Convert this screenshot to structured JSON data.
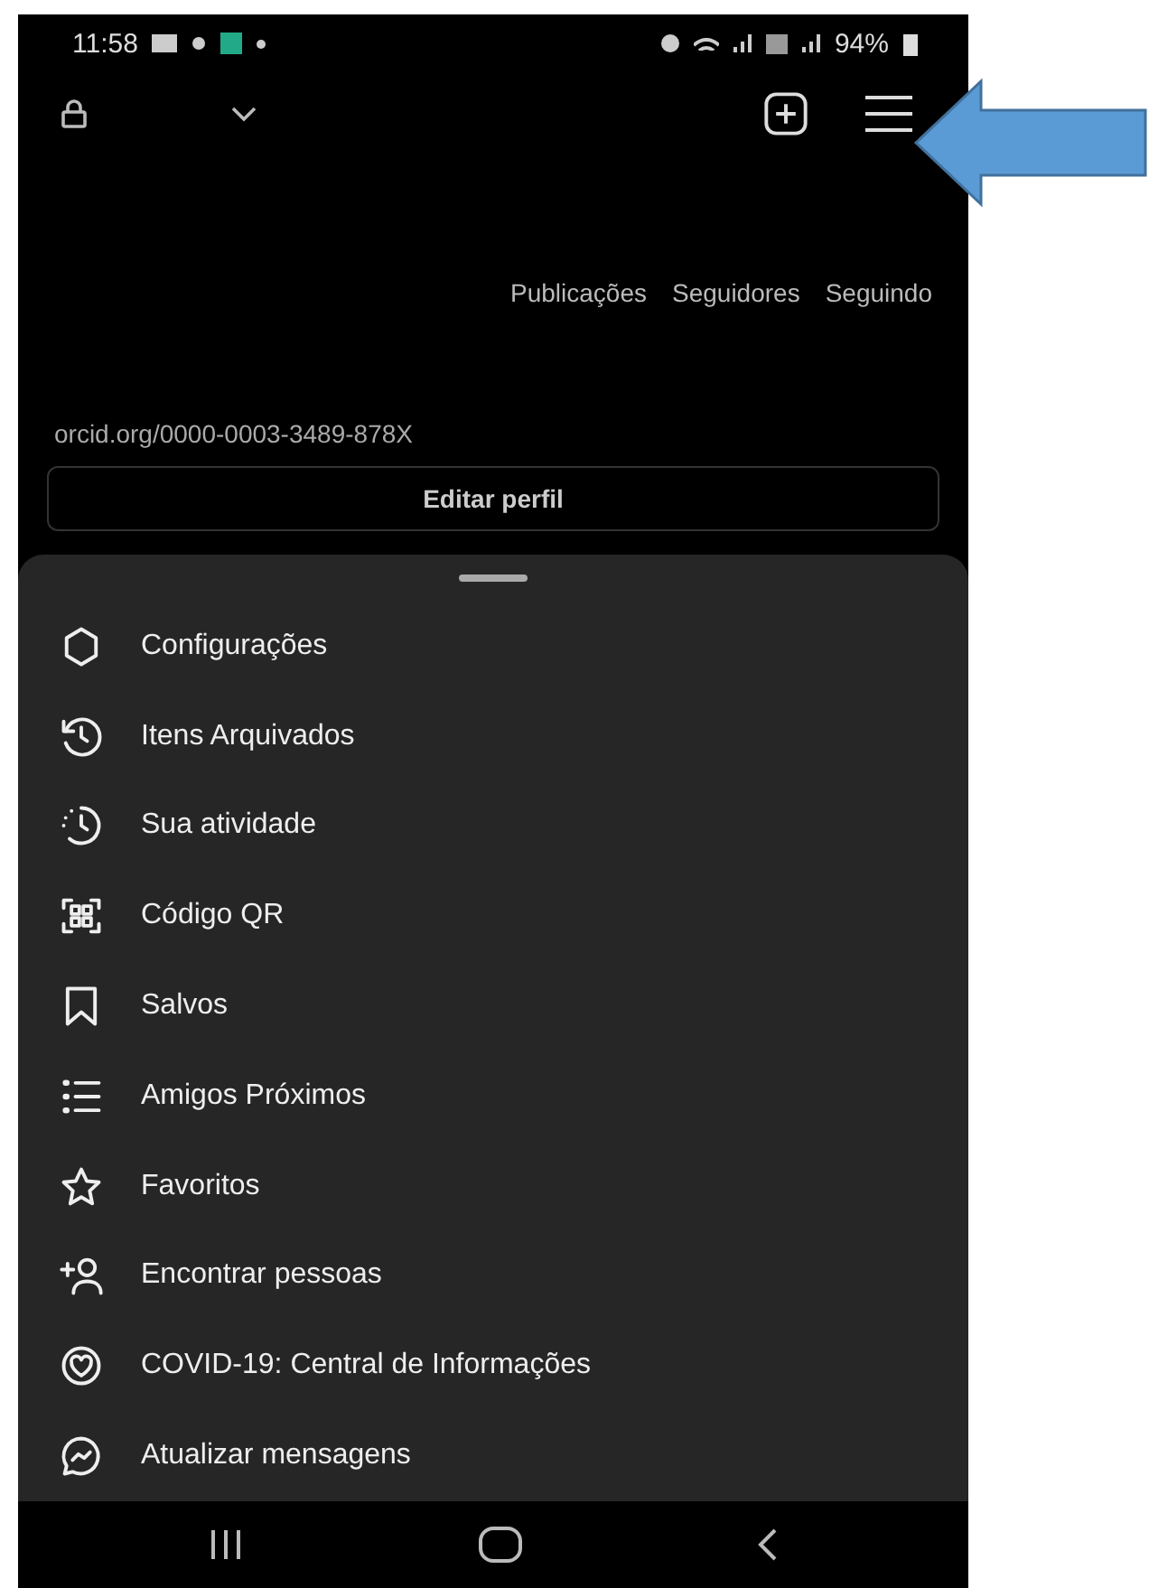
{
  "status_bar": {
    "time": "11:58",
    "battery": "94%"
  },
  "profile": {
    "stats": [
      "Publicações",
      "Seguidores",
      "Seguindo"
    ],
    "link": "orcid.org/0000-0003-3489-878X",
    "edit_button": "Editar perfil"
  },
  "menu": {
    "items": [
      {
        "label": "Configurações",
        "kind": "settings"
      },
      {
        "label": "Itens Arquivados",
        "kind": "archive"
      },
      {
        "label": "Sua atividade",
        "kind": "activity"
      },
      {
        "label": "Código QR",
        "kind": "qr"
      },
      {
        "label": "Salvos",
        "kind": "bookmark"
      },
      {
        "label": "Amigos Próximos",
        "kind": "list"
      },
      {
        "label": "Favoritos",
        "kind": "star"
      },
      {
        "label": "Encontrar pessoas",
        "kind": "person"
      },
      {
        "label": "COVID-19: Central de Informações",
        "kind": "heart"
      },
      {
        "label": "Atualizar mensagens",
        "kind": "chat"
      }
    ]
  }
}
